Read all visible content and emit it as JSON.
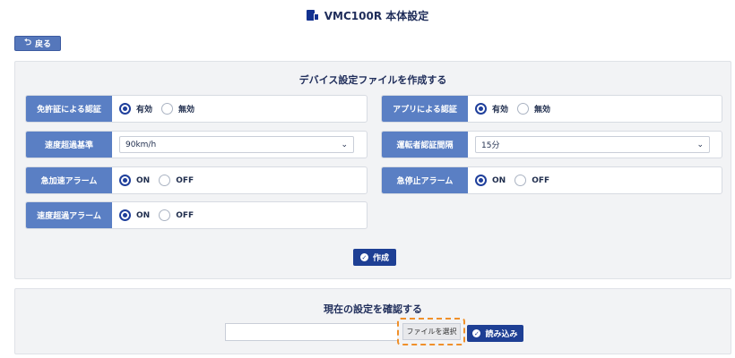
{
  "header": {
    "title": "VMC100R 本体設定"
  },
  "back_label": "戻る",
  "create_section": {
    "title": "デバイス設定ファイルを作成する",
    "license_auth": {
      "label": "免許証による認証",
      "options": [
        "有効",
        "無効"
      ],
      "selected": "有効"
    },
    "app_auth": {
      "label": "アプリによる認証",
      "options": [
        "有効",
        "無効"
      ],
      "selected": "有効"
    },
    "speed_limit": {
      "label": "速度超過基準",
      "value": "90km/h"
    },
    "driver_auth_interval": {
      "label": "運転者認証間隔",
      "value": "15分"
    },
    "accel_alarm": {
      "label": "急加速アラーム",
      "options": [
        "ON",
        "OFF"
      ],
      "selected": "ON"
    },
    "stop_alarm": {
      "label": "急停止アラーム",
      "options": [
        "ON",
        "OFF"
      ],
      "selected": "ON"
    },
    "speed_alarm": {
      "label": "速度超過アラーム",
      "options": [
        "ON",
        "OFF"
      ],
      "selected": "ON"
    },
    "create_label": "作成"
  },
  "confirm_section": {
    "title": "現在の設定を確認する",
    "choose_file_label": "ファイルを選択",
    "load_label": "読み込み"
  },
  "icons": {
    "device": "device-icon",
    "back": "undo-arrow-icon",
    "check": "check-circle-icon",
    "chevron": "chevron-down-icon"
  },
  "colors": {
    "label_bg": "#5a7fc4",
    "primary": "#1e3f94",
    "highlight": "#f0902a"
  }
}
